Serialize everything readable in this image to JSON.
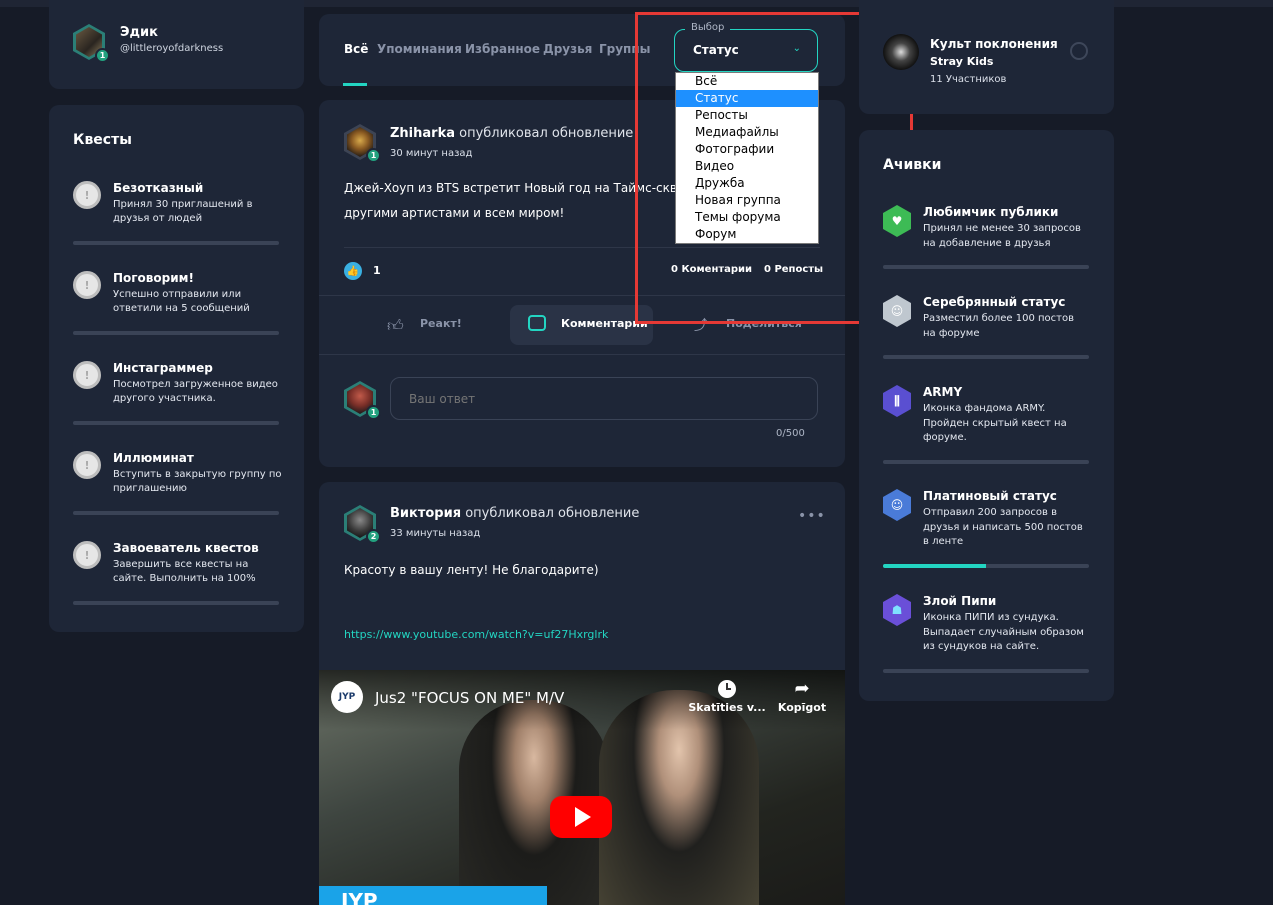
{
  "profile": {
    "name": "Эдик",
    "handle": "@littleroyofdarkness",
    "level": "1"
  },
  "quests": {
    "title": "Квесты",
    "items": [
      {
        "title": "Безотказный",
        "desc": "Принял 30 приглашений в друзья от людей"
      },
      {
        "title": "Поговорим!",
        "desc": "Успешно отправили или ответили на 5 сообщений"
      },
      {
        "title": "Инстаграммер",
        "desc": "Посмотрел загруженное видео другого участника."
      },
      {
        "title": "Иллюминат",
        "desc": "Вступить в закрытую группу по приглашению"
      },
      {
        "title": "Завоеватель квестов",
        "desc": "Завершить все квесты на сайте. Выполнить на 100%"
      }
    ]
  },
  "feed": {
    "tabs": [
      "Всё",
      "Упоминания",
      "Избранное",
      "Друзья",
      "Группы"
    ],
    "filter": {
      "legend": "Выбор",
      "value": "Статус"
    },
    "dropdown_options": [
      "Всё",
      "Статус",
      "Репосты",
      "Медиафайлы",
      "Фотографии",
      "Видео",
      "Дружба",
      "Новая группа",
      "Темы форума",
      "Форум"
    ]
  },
  "post1": {
    "author": "Zhiharka",
    "action": "опубликовал обновление",
    "time": "30 минут назад",
    "level": "1",
    "text_line1": "Джей-Хоуп из BTS встретит Новый год на Таймс-сквер вм",
    "text_line2": "другими артистами и всем миром!",
    "likes": "1",
    "comments": "0 Коментарии",
    "reposts": "0 Репосты",
    "react_label": "Реакт!",
    "comment_label": "Комментарии",
    "share_label": "Поделиться",
    "reply_placeholder": "Ваш ответ",
    "reply_level": "1",
    "char_count": "0/500"
  },
  "post2": {
    "author": "Виктория",
    "action": "опубликовал обновление",
    "time": "33 минуты назад",
    "level": "2",
    "text": "Красоту в вашу ленту! Не благодарите)",
    "link": "https://www.youtube.com/watch?v=uf27Hxrglrk",
    "video": {
      "channel_logo": "JYP",
      "title": "Jus2 \"FOCUS ON ME\" M/V",
      "watch_later": "Skatīties v...",
      "share": "Kopīgot",
      "banner_text": "JYP"
    }
  },
  "group": {
    "name": "Культ поклонения",
    "subname": "Stray Kids",
    "members": "11 Участников"
  },
  "achievements": {
    "title": "Ачивки",
    "items": [
      {
        "title": "Любимчик публики",
        "desc": "Принял не менее 30 запросов на добавление в друзья",
        "progress": 0
      },
      {
        "title": "Серебрянный статус",
        "desc": "Разместил более 100 постов на форуме",
        "progress": 0
      },
      {
        "title": "ARMY",
        "desc": "Иконка фандома ARMY. Пройден скрытый квест на форуме.",
        "progress": 0
      },
      {
        "title": "Платиновый статус",
        "desc": "Отправил 200 запросов в друзья и написать 500 постов в ленте",
        "progress": 0.5
      },
      {
        "title": "Злой Пипи",
        "desc": "Иконка ПИПИ из сундука. Выпадает случайным образом из сундуков на сайте.",
        "progress": 0
      }
    ]
  },
  "colors": {
    "accent": "#23d5c2",
    "card": "#1e2637",
    "background": "#161b27",
    "highlight_box": "#e53935",
    "selected_option": "#1e90ff"
  }
}
